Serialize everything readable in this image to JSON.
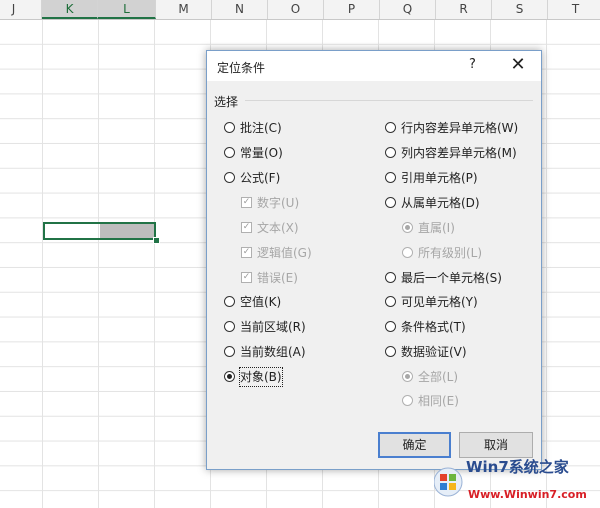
{
  "sheet": {
    "columns": [
      "J",
      "K",
      "L",
      "M",
      "N",
      "O",
      "P",
      "Q",
      "R",
      "S",
      "T"
    ],
    "selected_columns": [
      "K",
      "L"
    ]
  },
  "dialog": {
    "title": "定位条件",
    "help": "?",
    "close": "✕",
    "group_label": "选择",
    "left_options": [
      {
        "label": "批注(C)",
        "type": "radio",
        "checked": false,
        "enabled": true
      },
      {
        "label": "常量(O)",
        "type": "radio",
        "checked": false,
        "enabled": true
      },
      {
        "label": "公式(F)",
        "type": "radio",
        "checked": false,
        "enabled": true
      },
      {
        "label": "数字(U)",
        "type": "checkbox",
        "checked": true,
        "enabled": false
      },
      {
        "label": "文本(X)",
        "type": "checkbox",
        "checked": true,
        "enabled": false
      },
      {
        "label": "逻辑值(G)",
        "type": "checkbox",
        "checked": true,
        "enabled": false
      },
      {
        "label": "错误(E)",
        "type": "checkbox",
        "checked": true,
        "enabled": false
      },
      {
        "label": "空值(K)",
        "type": "radio",
        "checked": false,
        "enabled": true
      },
      {
        "label": "当前区域(R)",
        "type": "radio",
        "checked": false,
        "enabled": true
      },
      {
        "label": "当前数组(A)",
        "type": "radio",
        "checked": false,
        "enabled": true
      },
      {
        "label": "对象(B)",
        "type": "radio",
        "checked": true,
        "enabled": true
      }
    ],
    "right_options": [
      {
        "label": "行内容差异单元格(W)",
        "type": "radio",
        "checked": false,
        "enabled": true
      },
      {
        "label": "列内容差异单元格(M)",
        "type": "radio",
        "checked": false,
        "enabled": true
      },
      {
        "label": "引用单元格(P)",
        "type": "radio",
        "checked": false,
        "enabled": true
      },
      {
        "label": "从属单元格(D)",
        "type": "radio",
        "checked": false,
        "enabled": true
      },
      {
        "label": "直属(I)",
        "type": "radio",
        "checked": true,
        "enabled": false
      },
      {
        "label": "所有级别(L)",
        "type": "radio",
        "checked": false,
        "enabled": false
      },
      {
        "label": "最后一个单元格(S)",
        "type": "radio",
        "checked": false,
        "enabled": true
      },
      {
        "label": "可见单元格(Y)",
        "type": "radio",
        "checked": false,
        "enabled": true
      },
      {
        "label": "条件格式(T)",
        "type": "radio",
        "checked": false,
        "enabled": true
      },
      {
        "label": "数据验证(V)",
        "type": "radio",
        "checked": false,
        "enabled": true
      },
      {
        "label": "全部(L)",
        "type": "radio",
        "checked": true,
        "enabled": false
      },
      {
        "label": "相同(E)",
        "type": "radio",
        "checked": false,
        "enabled": false
      }
    ],
    "ok_label": "确定",
    "cancel_label": "取消"
  },
  "watermark": {
    "name": "Win7系统之家",
    "url": "Www.Winwin7.com"
  },
  "colors": {
    "excel_green": "#217346",
    "dialog_bg": "#f0f0f0",
    "default_button_border": "#4a7fcf"
  }
}
